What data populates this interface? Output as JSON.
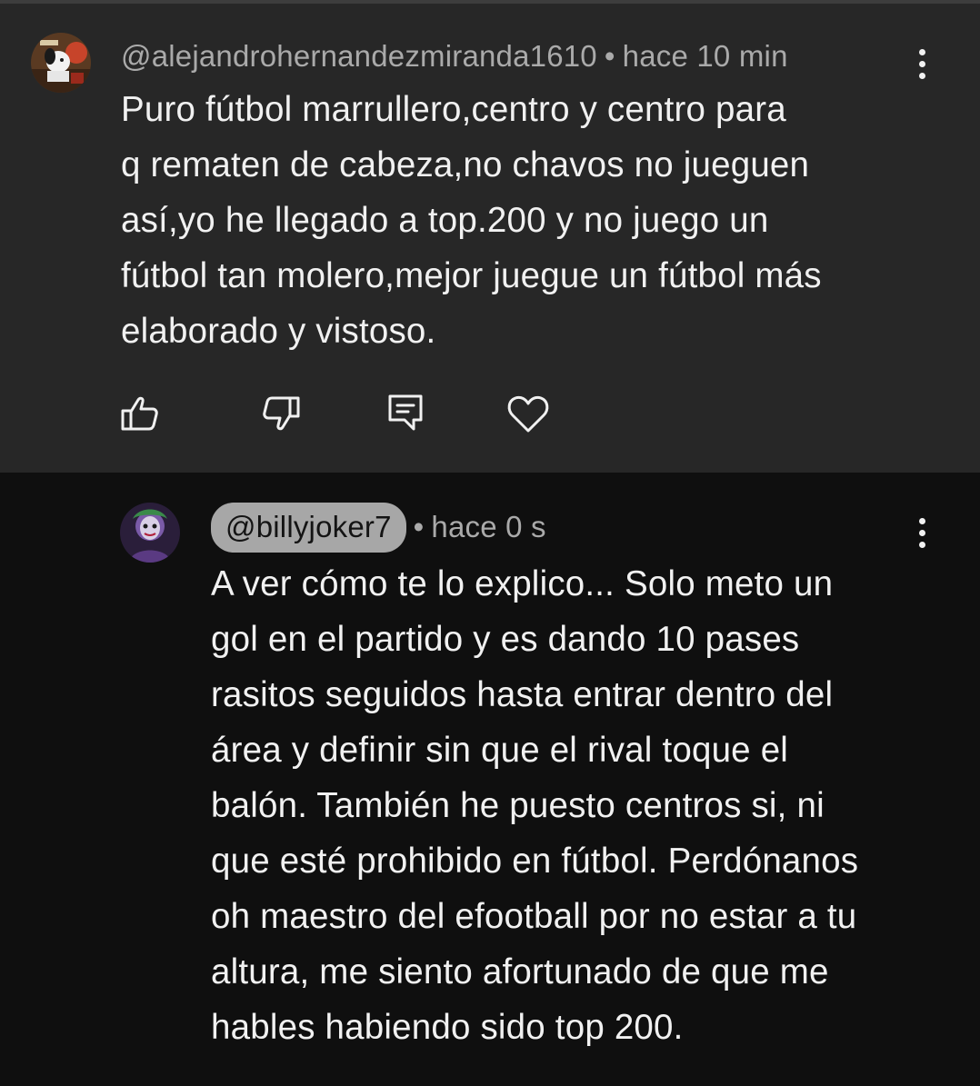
{
  "comment": {
    "author": "@alejandrohernandezmiranda1610",
    "separator": "•",
    "time": "hace 10 min",
    "lines": [
      "Puro fútbol marrullero,centro y centro para",
      "q rematen de cabeza,no chavos no jueguen",
      "así,yo he llegado a top.200 y no juego un",
      "fútbol tan molero,mejor juegue un fútbol más",
      "elaborado y vistoso."
    ],
    "actions": [
      "like-icon",
      "dislike-icon",
      "reply-icon",
      "heart-icon"
    ]
  },
  "reply": {
    "author": "@billyjoker7",
    "separator": "•",
    "time": "hace 0 s",
    "lines": [
      "A ver cómo te lo explico... Solo meto un",
      "gol en el partido y es dando 10 pases",
      "rasitos seguidos hasta entrar dentro del",
      "área y definir sin que el rival toque el",
      "balón. También he puesto centros si, ni",
      "que esté prohibido en fútbol. Perdónanos",
      "oh maestro del efootball por no estar a tu",
      "altura, me siento afortunado de que me",
      "hables habiendo sido top 200."
    ]
  },
  "colors": {
    "main_bg": "#272727",
    "reply_bg": "#0f0f0f",
    "text": "#f1f1f1",
    "meta": "#aaaaaa",
    "handle_pill": "#a7a7a7"
  }
}
